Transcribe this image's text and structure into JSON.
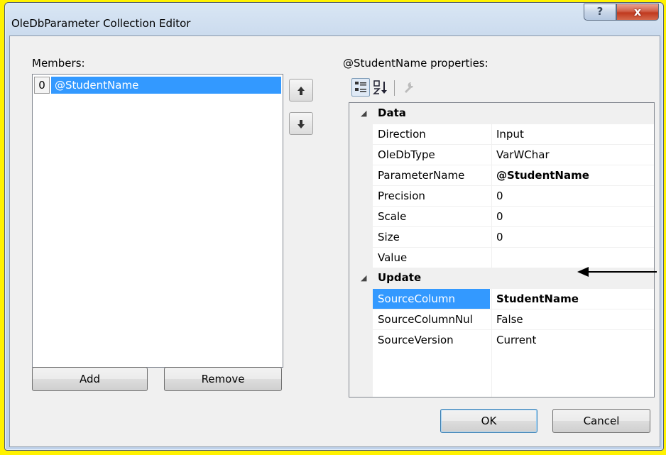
{
  "window": {
    "title": "OleDbParameter Collection Editor",
    "help_glyph": "?",
    "close_glyph": "x"
  },
  "members": {
    "label": "Members:",
    "items": [
      {
        "index": "0",
        "name": "@StudentName",
        "selected": true
      }
    ],
    "move_up_glyph": "🡅",
    "move_down_glyph": "🡇",
    "add_label": "Add",
    "remove_label": "Remove"
  },
  "properties": {
    "label": "@StudentName properties:",
    "categories": [
      {
        "name": "Data",
        "rows": [
          {
            "name": "Direction",
            "value": "Input",
            "bold": false
          },
          {
            "name": "OleDbType",
            "value": "VarWChar",
            "bold": false
          },
          {
            "name": "ParameterName",
            "value": "@StudentName",
            "bold": true
          },
          {
            "name": "Precision",
            "value": "0",
            "bold": false
          },
          {
            "name": "Scale",
            "value": "0",
            "bold": false
          },
          {
            "name": "Size",
            "value": "0",
            "bold": false
          },
          {
            "name": "Value",
            "value": "",
            "bold": false
          }
        ]
      },
      {
        "name": "Update",
        "rows": [
          {
            "name": "SourceColumn",
            "value": "StudentName",
            "bold": true,
            "selected": true
          },
          {
            "name": "SourceColumnNul",
            "value": "False",
            "bold": false
          },
          {
            "name": "SourceVersion",
            "value": "Current",
            "bold": false
          }
        ]
      }
    ],
    "expand_glyph": "◢"
  },
  "footer": {
    "ok_label": "OK",
    "cancel_label": "Cancel"
  },
  "colors": {
    "background": "#fff200",
    "selection": "#3399ff",
    "annotation_arrow": "#000000"
  }
}
